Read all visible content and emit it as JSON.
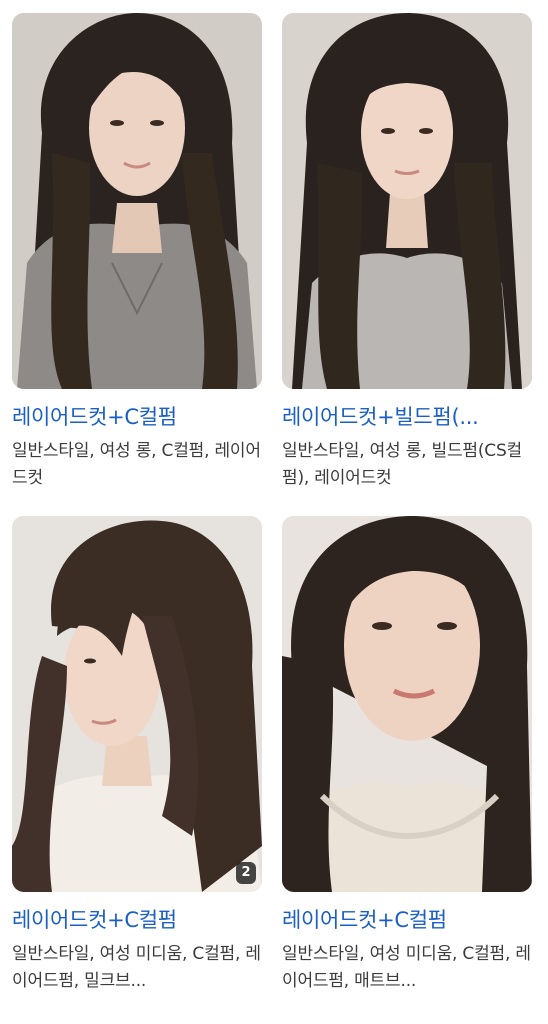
{
  "results": [
    {
      "title": "레이어드컷+C컬펌",
      "description": "일반스타일, 여성 롱, C컬펌, 레이어드컷",
      "badge": "",
      "image": "woman-long-layered-hair-gray-cardigan"
    },
    {
      "title": "레이어드컷+빌드펌(...",
      "description": "일반스타일, 여성 롱, 빌드펌(CS컬펌), 레이어드컷",
      "badge": "",
      "image": "woman-long-layered-hair-bangs-knit"
    },
    {
      "title": "레이어드컷+C컬펌",
      "description": "일반스타일, 여성 미디움, C컬펌, 레이어드펌, 밀크브...",
      "badge": "2",
      "image": "woman-medium-layered-hair-side-bangs"
    },
    {
      "title": "레이어드컷+C컬펌",
      "description": "일반스타일, 여성 미디움, C컬펌, 레이어드펌, 매트브...",
      "badge": "",
      "image": "woman-medium-layered-hair-closeup"
    }
  ],
  "colors": {
    "title_link": "#1a5fc6",
    "description": "#3c3c3c",
    "hair": "#2a221e",
    "skin": "#ecd3c3"
  }
}
